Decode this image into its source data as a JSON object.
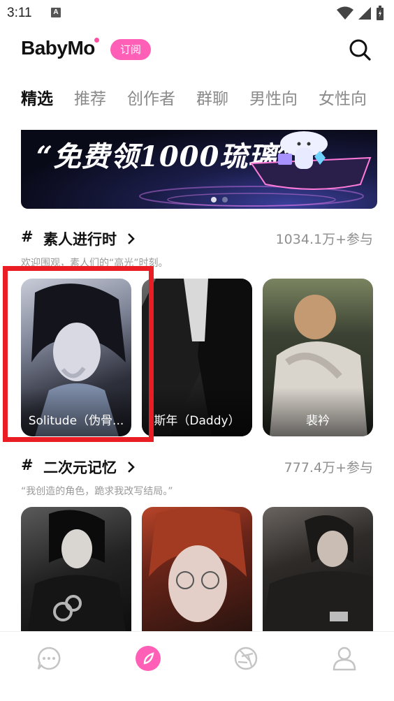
{
  "status": {
    "time": "3:11",
    "notif_letter": "A"
  },
  "header": {
    "logo": "BabyMo",
    "subscribe": "订阅"
  },
  "tabs": [
    "精选",
    "推荐",
    "创作者",
    "群聊",
    "男性向",
    "女性向"
  ],
  "banner": {
    "text": "“免费领1000琉璃”"
  },
  "sections": [
    {
      "hash": "#",
      "title": "素人进行时",
      "count": "1034.1万+参与",
      "desc": "欢迎围观，素人们的“高光”时刻。",
      "cards": [
        {
          "label": "Solitude（伪骨..."
        },
        {
          "label": "斯年（Daddy）"
        },
        {
          "label": "裴衿"
        }
      ]
    },
    {
      "hash": "#",
      "title": "二次元记忆",
      "count": "777.4万+参与",
      "desc": "“我创造的角色，跪求我改写结局。”",
      "cards": [
        {
          "label": ""
        },
        {
          "label": ""
        },
        {
          "label": ""
        }
      ]
    }
  ],
  "nav": [
    "chat-icon",
    "discover-icon",
    "aperture-icon",
    "profile-icon"
  ],
  "colors": {
    "accent": "#ff5fb6",
    "highlight": "#ea1c24"
  }
}
